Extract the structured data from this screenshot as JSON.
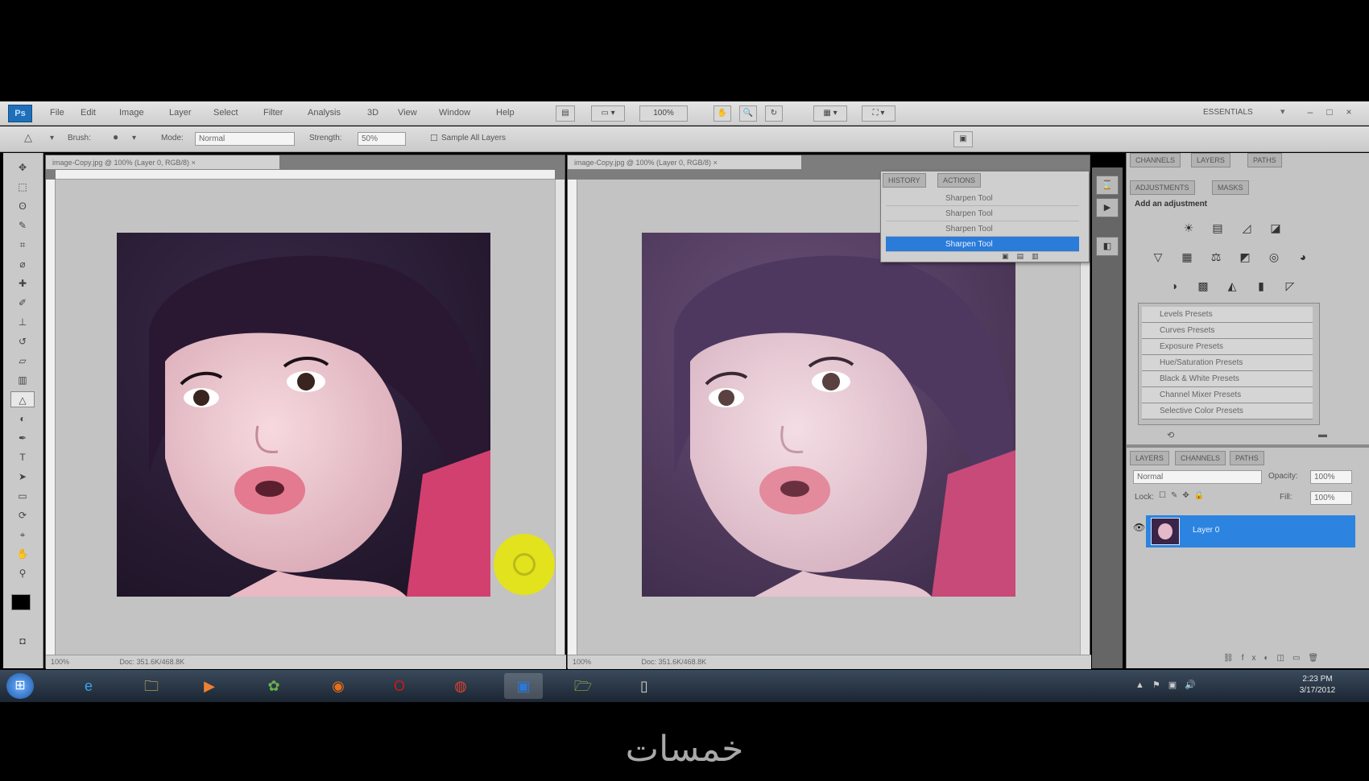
{
  "app": {
    "menus": [
      "File",
      "Edit",
      "Image",
      "Layer",
      "Select",
      "Filter",
      "Analysis",
      "3D",
      "View",
      "Window",
      "Help"
    ],
    "zoom": "100%",
    "workspace": "ESSENTIALS"
  },
  "options": {
    "brush_label": "Brush:",
    "mode_label": "Mode:",
    "mode_value": "Normal",
    "strength_label": "Strength:",
    "strength_value": "50%",
    "sample_all_layers": "Sample All Layers"
  },
  "docs": {
    "left_tab": "image-Copy.jpg @ 100% (Layer 0, RGB/8)",
    "right_tab": "image-Copy.jpg @ 100% (Layer 0, RGB/8)",
    "left_zoom": "100%",
    "right_zoom": "100%",
    "left_status": "Doc: 351.6K/468.8K",
    "right_status": "Doc: 351.6K/468.8K"
  },
  "history": {
    "tabs": [
      "HISTORY",
      "ACTIONS"
    ],
    "items": [
      "Sharpen Tool",
      "Sharpen Tool",
      "Sharpen Tool",
      "Sharpen Tool"
    ]
  },
  "panels": {
    "top_tabs": [
      "CHANNELS",
      "LAYERS",
      "PATHS"
    ],
    "adj_tabs": [
      "ADJUSTMENTS",
      "MASKS"
    ],
    "adj_title": "Add an adjustment",
    "presets": [
      "Levels Presets",
      "Curves Presets",
      "Exposure Presets",
      "Hue/Saturation Presets",
      "Black & White Presets",
      "Channel Mixer Presets",
      "Selective Color Presets"
    ],
    "layer_tabs": [
      "LAYERS",
      "CHANNELS",
      "PATHS"
    ],
    "blend_mode": "Normal",
    "opacity_label": "Opacity:",
    "opacity_value": "100%",
    "lock_label": "Lock:",
    "fill_label": "Fill:",
    "fill_value": "100%",
    "layer_name": "Layer 0"
  },
  "taskbar": {
    "time": "2:23 PM",
    "date": "3/17/2012"
  },
  "watermark": "خمسات",
  "colors": {
    "selection_blue": "#2b7bd9",
    "highlight_yellow": "#e9e90a"
  }
}
